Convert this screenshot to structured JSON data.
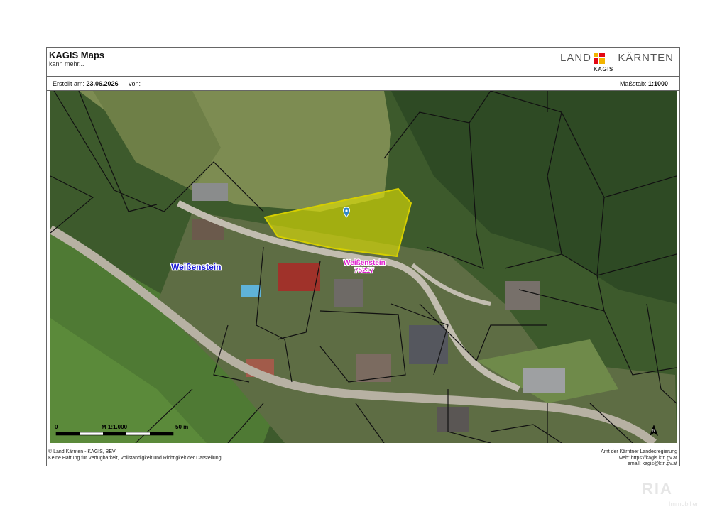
{
  "header": {
    "title": "KAGIS Maps",
    "subtitle": "kann mehr...",
    "logo_left": "LAND",
    "logo_right": "KÄRNTEN",
    "logo_sub": "KAGIS"
  },
  "info": {
    "created_label": "Erstellt am:",
    "created_date": "23.06.2026",
    "from_label": "von:",
    "scale_label": "Maßstab:",
    "scale_value": "1:1000"
  },
  "map": {
    "place_label": "Weißenstein",
    "plot_label_line1": "Weißenstein",
    "plot_label_line2": "75217",
    "scalebar_zero": "0",
    "scalebar_mid": "M 1:1.000",
    "scalebar_end": "50 m",
    "north_arrow_icon": "north-arrow-icon",
    "marker_icon": "location-marker-icon",
    "highlight_color": "#e6e600"
  },
  "footer": {
    "left_line1": "© Land Kärnten - KAGIS, BEV",
    "left_line2": "Keine Haftung für Verfügbarkeit, Vollständigkeit und Richtigkeit der Darstellung.",
    "right_line1": "Amt der Kärntner Landesregierung",
    "right_line2": "web: https://kagis.ktn.gv.at",
    "right_line3": "email: kagis@ktn.gv.at"
  },
  "watermark": {
    "line1": "RIA",
    "line2": "Immobilien"
  }
}
